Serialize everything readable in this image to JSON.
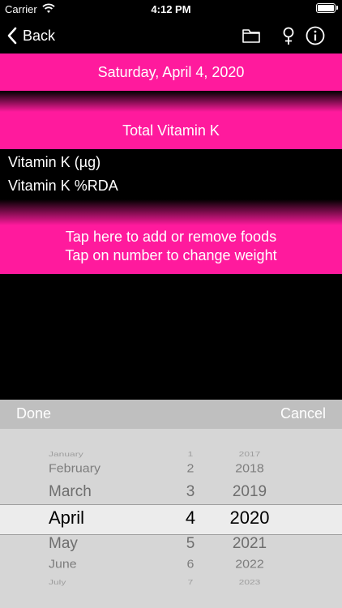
{
  "status_bar": {
    "carrier": "Carrier",
    "time": "4:12 PM"
  },
  "nav": {
    "back_label": "Back",
    "icons": [
      "folder-icon",
      "female-icon",
      "info-icon"
    ]
  },
  "date_label": "Saturday, April 4, 2020",
  "total_label": "Total Vitamin K",
  "nutrient_rows": [
    "Vitamin K (µg)",
    "Vitamin K %RDA"
  ],
  "tap_instructions": {
    "line1": "Tap here to add or remove foods",
    "line2": "Tap on number to change weight"
  },
  "picker": {
    "done_label": "Done",
    "cancel_label": "Cancel",
    "months": [
      "January",
      "February",
      "March",
      "April",
      "May",
      "June",
      "July"
    ],
    "days": [
      "1",
      "2",
      "3",
      "4",
      "5",
      "6",
      "7"
    ],
    "years": [
      "2017",
      "2018",
      "2019",
      "2020",
      "2021",
      "2022",
      "2023"
    ],
    "selected_index": 3
  },
  "colors": {
    "accent": "#ff1a9d",
    "background": "#000000",
    "picker_background": "#d6d6d6"
  }
}
